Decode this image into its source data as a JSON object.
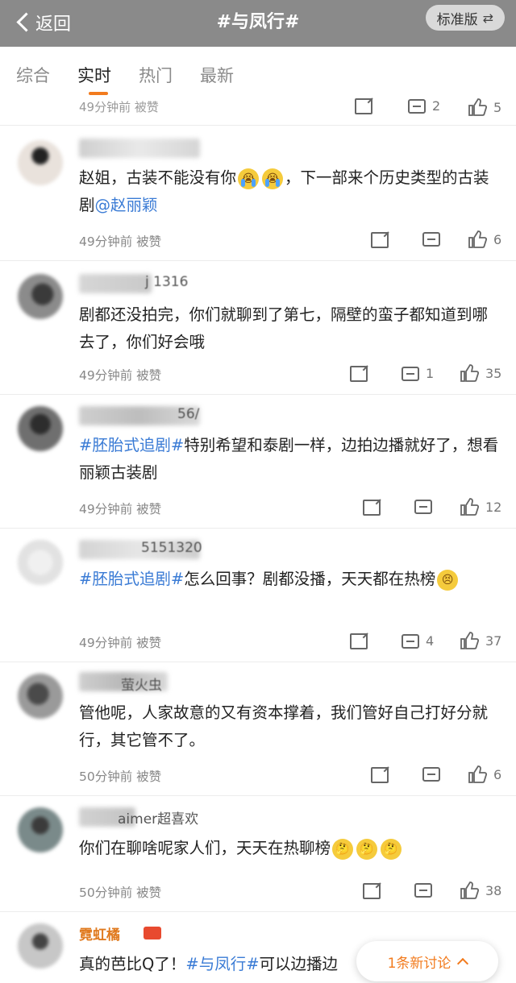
{
  "header": {
    "back_label": "返回",
    "title": "#与凤行#",
    "standard_label": "标准版",
    "swap_icon": "swap-icon"
  },
  "tabs": [
    {
      "label": "综合",
      "active": false
    },
    {
      "label": "实时",
      "active": true
    },
    {
      "label": "热门",
      "active": false
    },
    {
      "label": "最新",
      "active": false
    }
  ],
  "cut_row": {
    "meta": "49分钟前 被赞",
    "comments": "2",
    "likes": "5"
  },
  "comments": [
    {
      "visible_name": "",
      "segments": [
        {
          "t": "赵姐，古装不能没有你",
          "c": ""
        },
        {
          "t": "😭",
          "c": "emoji cry"
        },
        {
          "t": "😭",
          "c": "emoji cry"
        },
        {
          "t": "，下一部来个历史类型的古装剧",
          "c": ""
        },
        {
          "t": "@赵丽颖",
          "c": "mention"
        }
      ],
      "time": "49分钟前 被赞",
      "comment_count": "",
      "like_count": "6"
    },
    {
      "visible_name": "j 1316",
      "segments": [
        {
          "t": "剧都还没拍完，你们就聊到了第七，隔壁的蛮子都知道到哪去了，你们好会哦",
          "c": ""
        }
      ],
      "time": "49分钟前 被赞",
      "comment_count": "1",
      "like_count": "35"
    },
    {
      "visible_name": "56/",
      "segments": [
        {
          "t": "#胚胎式追剧#",
          "c": "hashtag"
        },
        {
          "t": "特别希望和泰剧一样，边拍边播就好了，想看丽颖古装剧",
          "c": ""
        }
      ],
      "time": "49分钟前 被赞",
      "comment_count": "",
      "like_count": "12"
    },
    {
      "visible_name": "5151320",
      "segments": [
        {
          "t": "#胚胎式追剧#",
          "c": "hashtag"
        },
        {
          "t": "怎么回事？剧都没播，天天都在热榜",
          "c": ""
        },
        {
          "t": "😣",
          "c": "emoji"
        }
      ],
      "time": "49分钟前 被赞",
      "comment_count": "4",
      "like_count": "37"
    },
    {
      "visible_name": "萤火虫",
      "segments": [
        {
          "t": "管他呢，人家故意的又有资本撑着，我们管好自己打好分就行，其它管不了。",
          "c": ""
        }
      ],
      "time": "50分钟前 被赞",
      "comment_count": "",
      "like_count": "6"
    },
    {
      "visible_name": "aimer超喜欢",
      "segments": [
        {
          "t": "你们在聊啥呢家人们，天天在热聊榜",
          "c": ""
        },
        {
          "t": "🤔",
          "c": "emoji"
        },
        {
          "t": "🤔",
          "c": "emoji"
        },
        {
          "t": "🤔",
          "c": "emoji"
        }
      ],
      "time": "50分钟前 被赞",
      "comment_count": "",
      "like_count": "38"
    },
    {
      "visible_name": "霓虹橘",
      "segments": [
        {
          "t": "真的芭比Q了！",
          "c": ""
        },
        {
          "t": "#与凤行#",
          "c": "hashtag"
        },
        {
          "t": "可以边播边",
          "c": ""
        }
      ],
      "time": "",
      "comment_count": "",
      "like_count": ""
    }
  ],
  "new_discussion": {
    "label": "1条新讨论",
    "icon": "chevron-up-icon"
  },
  "colors": {
    "header_bg": "#8a8a8a",
    "accent": "#f27b1e",
    "link": "#3a7bd5"
  }
}
